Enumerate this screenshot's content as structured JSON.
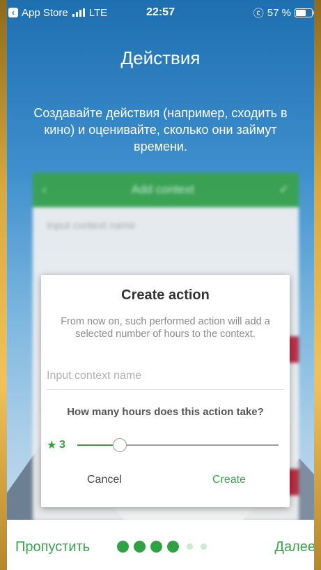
{
  "status_bar": {
    "back_app": "App Store",
    "network": "LTE",
    "time": "22:57",
    "battery_text": "57 %",
    "battery_level": 0.57
  },
  "screen": {
    "title": "Действия",
    "subtitle": "Создавайте действия (например, сходить в кино) и оценивайте, сколько они займут времени."
  },
  "background_card": {
    "title": "Add context",
    "input_placeholder": "Input context name"
  },
  "dialog": {
    "title": "Create action",
    "description": "From now on, such performed action will add a selected number of hours to the context.",
    "input_placeholder": "Input context name",
    "question": "How many hours does this action take?",
    "hours_value": "3",
    "slider_fraction": 0.21,
    "cancel_label": "Cancel",
    "create_label": "Create"
  },
  "onboarding_nav": {
    "skip_label": "Пропустить",
    "next_label": "Далее",
    "pages_total": 6,
    "current_page": 4
  },
  "colors": {
    "accent": "#3aa34a",
    "header_green": "#3aa34a",
    "sky_top": "#1d6fb0"
  }
}
